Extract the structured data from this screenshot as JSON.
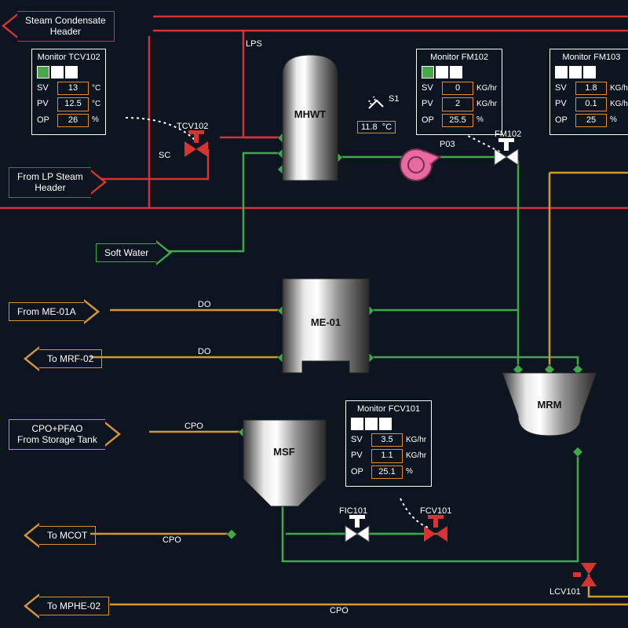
{
  "arrows": {
    "steam_condensate": "Steam Condensate\nHeader",
    "lp_steam": "From LP Steam\nHeader",
    "soft_water": "Soft Water",
    "me01a": "From ME-01A",
    "mrf02": "To MRF-02",
    "cpo_pfao": "CPO+PFAO\nFrom Storage Tank",
    "mcot": "To MCOT",
    "mphe02": "To MPHE-02"
  },
  "vessels": {
    "mhwt": "MHWT",
    "me01": "ME-01",
    "msf": "MSF",
    "mrm": "MRM"
  },
  "tags": {
    "lps": "LPS",
    "sc": "SC",
    "s1": "S1",
    "tcv102": "TCV102",
    "p03": "P03",
    "fm102": "FM102",
    "do1": "DO",
    "do2": "DO",
    "cpo1": "CPO",
    "cpo2": "CPO",
    "cpo3": "CPO",
    "fic101": "FIC101",
    "fcv101": "FCV101",
    "lcv101": "LCV101"
  },
  "temp_s1": {
    "val": "11.8",
    "unit": "°C"
  },
  "monitors": {
    "tcv102": {
      "title": "Monitor TCV102",
      "status": [
        "green",
        "white",
        "white"
      ],
      "rows": [
        {
          "lbl": "SV",
          "val": "13",
          "unit": "°C"
        },
        {
          "lbl": "PV",
          "val": "12.5",
          "unit": "°C"
        },
        {
          "lbl": "OP",
          "val": "26",
          "unit": "%"
        }
      ]
    },
    "fm102": {
      "title": "Monitor FM102",
      "status": [
        "green",
        "white",
        "white"
      ],
      "rows": [
        {
          "lbl": "SV",
          "val": "0",
          "unit": "KG/hr"
        },
        {
          "lbl": "PV",
          "val": "2",
          "unit": "KG/hr"
        },
        {
          "lbl": "OP",
          "val": "25.5",
          "unit": "%"
        }
      ]
    },
    "fm103": {
      "title": "Monitor FM103",
      "status": [
        "white",
        "white",
        "white"
      ],
      "rows": [
        {
          "lbl": "SV",
          "val": "1.8",
          "unit": "KG/h"
        },
        {
          "lbl": "PV",
          "val": "0.1",
          "unit": "KG/h"
        },
        {
          "lbl": "OP",
          "val": "25",
          "unit": "%"
        }
      ]
    },
    "fcv101": {
      "title": "Monitor FCV101",
      "status": [
        "white",
        "white",
        "white"
      ],
      "rows": [
        {
          "lbl": "SV",
          "val": "3.5",
          "unit": "KG/hr"
        },
        {
          "lbl": "PV",
          "val": "1.1",
          "unit": "KG/hr"
        },
        {
          "lbl": "OP",
          "val": "25.1",
          "unit": "%"
        }
      ]
    }
  }
}
